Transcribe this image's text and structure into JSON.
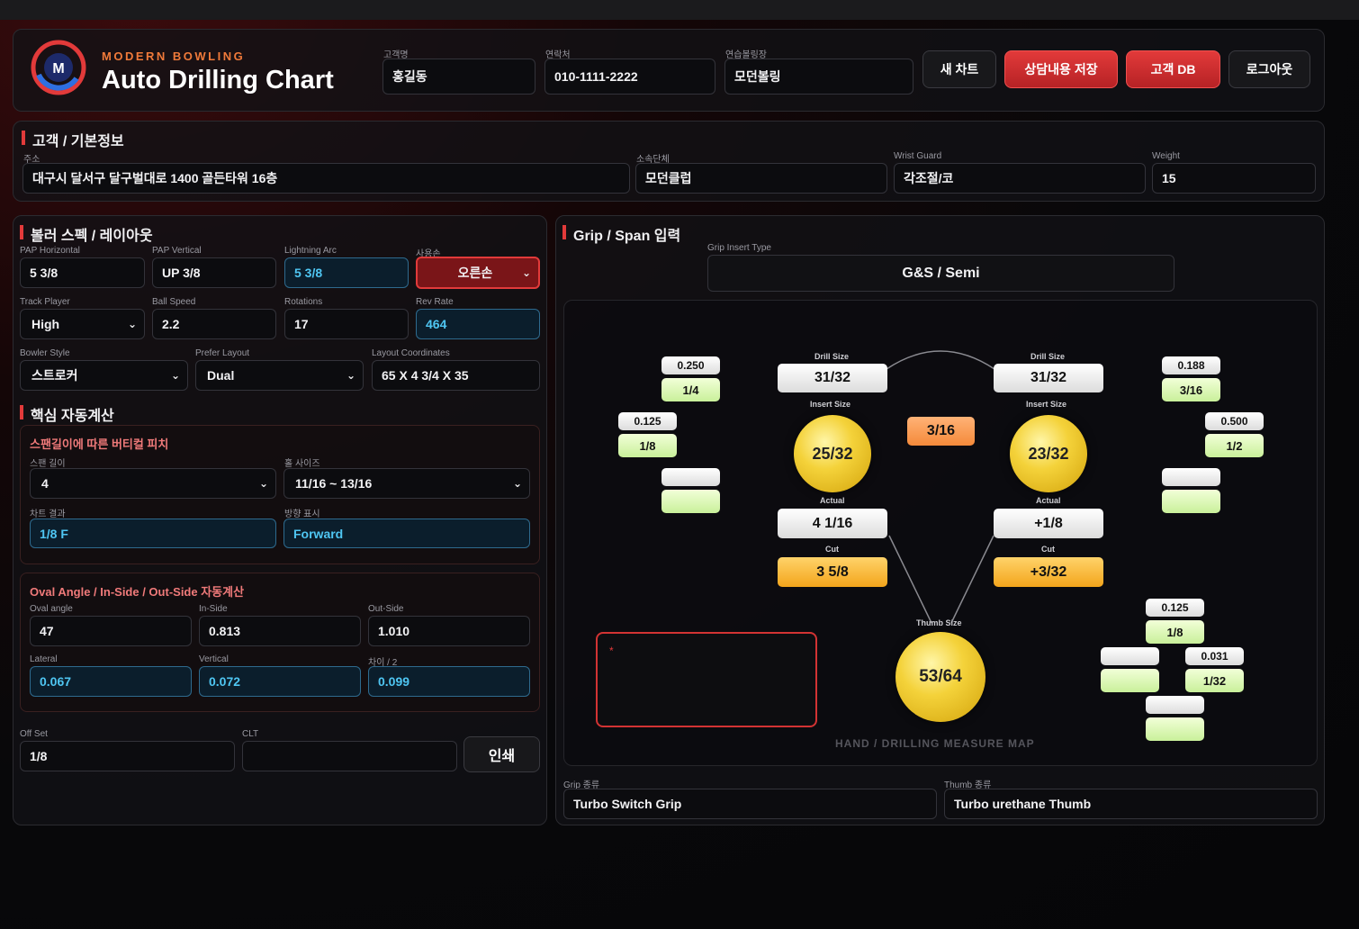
{
  "header": {
    "brand_sub": "MODERN BOWLING",
    "brand_title": "Auto Drilling Chart",
    "fields": [
      {
        "label": "고객명",
        "value": "홍길동"
      },
      {
        "label": "연락처",
        "value": "010-1111-2222"
      },
      {
        "label": "연습볼링장",
        "value": "모던볼링"
      }
    ],
    "buttons": {
      "new_chart": "새 차트",
      "save_consult": "상담내용 저장",
      "customer_db": "고객 DB",
      "logout": "로그아웃"
    }
  },
  "basic": {
    "title": "고객 / 기본정보",
    "address": {
      "label": "주소",
      "value": "대구시 달서구 달구벌대로 1400 골든타워 16층"
    },
    "group": {
      "label": "소속단체",
      "value": "모던클럽"
    },
    "wrist": {
      "label": "Wrist Guard",
      "value": "각조절/코"
    },
    "weight": {
      "label": "Weight",
      "value": "15"
    }
  },
  "spec": {
    "title": "볼러 스펙 / 레이아웃",
    "pap_h": {
      "label": "PAP Horizontal",
      "value": "5 3/8"
    },
    "pap_v": {
      "label": "PAP Vertical",
      "value": "UP 3/8"
    },
    "arc": {
      "label": "Lightning Arc",
      "value": "5 3/8"
    },
    "hand": {
      "label": "사용손",
      "value": "오른손"
    },
    "track": {
      "label": "Track Player",
      "value": "High"
    },
    "speed": {
      "label": "Ball Speed",
      "value": "2.2"
    },
    "rot": {
      "label": "Rotations",
      "value": "17"
    },
    "rev": {
      "label": "Rev Rate",
      "value": "464"
    },
    "style": {
      "label": "Bowler Style",
      "value": "스트로커"
    },
    "layout": {
      "label": "Prefer Layout",
      "value": "Dual"
    },
    "coords": {
      "label": "Layout Coordinates",
      "value": "65 X 4 3/4 X 35"
    }
  },
  "calc": {
    "title": "핵심 자동계산",
    "pitch": {
      "title": "스팬길이에 따른 버티컬 피치",
      "span": {
        "label": "스팬 길이",
        "value": "4"
      },
      "hole": {
        "label": "홀 사이즈",
        "value": "11/16 ~ 13/16"
      },
      "result": {
        "label": "차트 결과",
        "value": "1/8 F"
      },
      "dir": {
        "label": "방향 표시",
        "value": "Forward"
      }
    },
    "oval": {
      "title": "Oval Angle / In-Side / Out-Side 자동계산",
      "angle": {
        "label": "Oval angle",
        "value": "47"
      },
      "inside": {
        "label": "In-Side",
        "value": "0.813"
      },
      "outside": {
        "label": "Out-Side",
        "value": "1.010"
      },
      "lateral": {
        "label": "Lateral",
        "value": "0.067"
      },
      "vertical": {
        "label": "Vertical",
        "value": "0.072"
      },
      "diff": {
        "label": "차이 / 2",
        "value": "0.099"
      }
    },
    "offset": {
      "label": "Off Set",
      "value": "1/8"
    },
    "clt": {
      "label": "CLT",
      "value": ""
    },
    "print": "인쇄"
  },
  "grip": {
    "title": "Grip / Span 입력",
    "insert_type": {
      "label": "Grip Insert Type",
      "value": "G&S / Semi"
    },
    "map": {
      "caption": "HAND / DRILLING MEASURE MAP",
      "drill_label": "Drill Size",
      "insert_label": "Insert Size",
      "actual_label": "Actual",
      "cut_label": "Cut",
      "thumb_label": "Thumb Size",
      "left": {
        "drill": "31/32",
        "insert": "25/32",
        "actual": "4 1/16",
        "cut": "3 5/8"
      },
      "right": {
        "drill": "31/32",
        "insert": "23/32",
        "actual": "+1/8",
        "cut": "+3/32"
      },
      "center": "3/16",
      "thumb": "53/64",
      "notes_marker": "*",
      "pairs": [
        {
          "top": "0.250",
          "bottom": "1/4"
        },
        {
          "top": "0.125",
          "bottom": "1/8"
        },
        {
          "top": "",
          "bottom": ""
        },
        {
          "top": "0.188",
          "bottom": "3/16"
        },
        {
          "top": "0.500",
          "bottom": "1/2"
        },
        {
          "top": "",
          "bottom": ""
        },
        {
          "top": "0.125",
          "bottom": "1/8"
        },
        {
          "top": "",
          "bottom": ""
        },
        {
          "top": "0.031",
          "bottom": "1/32"
        },
        {
          "top": "",
          "bottom": ""
        }
      ]
    },
    "grip_kind": {
      "label": "Grip 종류",
      "value": "Turbo Switch Grip"
    },
    "thumb_kind": {
      "label": "Thumb 종류",
      "value": "Turbo urethane Thumb"
    }
  },
  "colors": {
    "accent": "#e23a3a",
    "blue": "#4fc6f2",
    "ball": "#f4d23a",
    "chip_green": "#c9f09a",
    "cut_orange": "#f3a51b"
  }
}
